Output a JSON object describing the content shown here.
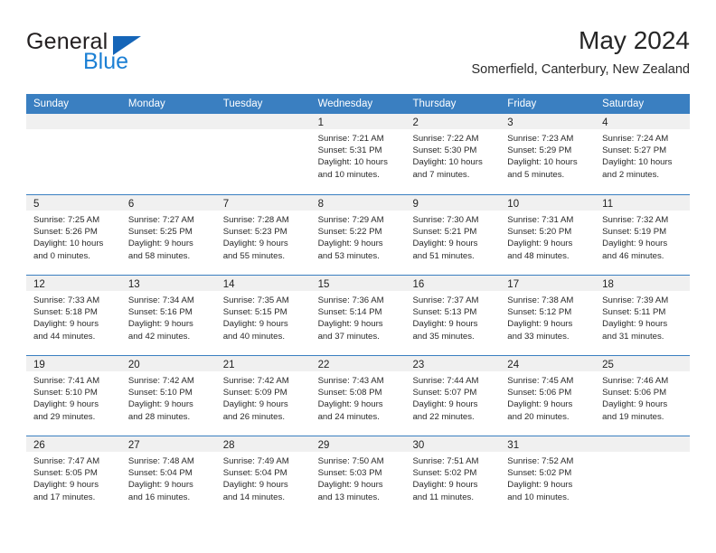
{
  "brand": {
    "name_top": "General",
    "name_bottom": "Blue",
    "triangle_color": "#1565b8",
    "blue_color": "#1b7fd4"
  },
  "header": {
    "title": "May 2024",
    "subtitle": "Somerfield, Canterbury, New Zealand"
  },
  "theme": {
    "header_blue": "#3a7fc1",
    "day_band_gray": "#f0f0f0",
    "text": "#222222"
  },
  "weekdays": [
    "Sunday",
    "Monday",
    "Tuesday",
    "Wednesday",
    "Thursday",
    "Friday",
    "Saturday"
  ],
  "weeks": [
    [
      {
        "day": "",
        "empty": true
      },
      {
        "day": "",
        "empty": true
      },
      {
        "day": "",
        "empty": true
      },
      {
        "day": "1",
        "sunrise": "Sunrise: 7:21 AM",
        "sunset": "Sunset: 5:31 PM",
        "daylight1": "Daylight: 10 hours",
        "daylight2": "and 10 minutes."
      },
      {
        "day": "2",
        "sunrise": "Sunrise: 7:22 AM",
        "sunset": "Sunset: 5:30 PM",
        "daylight1": "Daylight: 10 hours",
        "daylight2": "and 7 minutes."
      },
      {
        "day": "3",
        "sunrise": "Sunrise: 7:23 AM",
        "sunset": "Sunset: 5:29 PM",
        "daylight1": "Daylight: 10 hours",
        "daylight2": "and 5 minutes."
      },
      {
        "day": "4",
        "sunrise": "Sunrise: 7:24 AM",
        "sunset": "Sunset: 5:27 PM",
        "daylight1": "Daylight: 10 hours",
        "daylight2": "and 2 minutes."
      }
    ],
    [
      {
        "day": "5",
        "sunrise": "Sunrise: 7:25 AM",
        "sunset": "Sunset: 5:26 PM",
        "daylight1": "Daylight: 10 hours",
        "daylight2": "and 0 minutes."
      },
      {
        "day": "6",
        "sunrise": "Sunrise: 7:27 AM",
        "sunset": "Sunset: 5:25 PM",
        "daylight1": "Daylight: 9 hours",
        "daylight2": "and 58 minutes."
      },
      {
        "day": "7",
        "sunrise": "Sunrise: 7:28 AM",
        "sunset": "Sunset: 5:23 PM",
        "daylight1": "Daylight: 9 hours",
        "daylight2": "and 55 minutes."
      },
      {
        "day": "8",
        "sunrise": "Sunrise: 7:29 AM",
        "sunset": "Sunset: 5:22 PM",
        "daylight1": "Daylight: 9 hours",
        "daylight2": "and 53 minutes."
      },
      {
        "day": "9",
        "sunrise": "Sunrise: 7:30 AM",
        "sunset": "Sunset: 5:21 PM",
        "daylight1": "Daylight: 9 hours",
        "daylight2": "and 51 minutes."
      },
      {
        "day": "10",
        "sunrise": "Sunrise: 7:31 AM",
        "sunset": "Sunset: 5:20 PM",
        "daylight1": "Daylight: 9 hours",
        "daylight2": "and 48 minutes."
      },
      {
        "day": "11",
        "sunrise": "Sunrise: 7:32 AM",
        "sunset": "Sunset: 5:19 PM",
        "daylight1": "Daylight: 9 hours",
        "daylight2": "and 46 minutes."
      }
    ],
    [
      {
        "day": "12",
        "sunrise": "Sunrise: 7:33 AM",
        "sunset": "Sunset: 5:18 PM",
        "daylight1": "Daylight: 9 hours",
        "daylight2": "and 44 minutes."
      },
      {
        "day": "13",
        "sunrise": "Sunrise: 7:34 AM",
        "sunset": "Sunset: 5:16 PM",
        "daylight1": "Daylight: 9 hours",
        "daylight2": "and 42 minutes."
      },
      {
        "day": "14",
        "sunrise": "Sunrise: 7:35 AM",
        "sunset": "Sunset: 5:15 PM",
        "daylight1": "Daylight: 9 hours",
        "daylight2": "and 40 minutes."
      },
      {
        "day": "15",
        "sunrise": "Sunrise: 7:36 AM",
        "sunset": "Sunset: 5:14 PM",
        "daylight1": "Daylight: 9 hours",
        "daylight2": "and 37 minutes."
      },
      {
        "day": "16",
        "sunrise": "Sunrise: 7:37 AM",
        "sunset": "Sunset: 5:13 PM",
        "daylight1": "Daylight: 9 hours",
        "daylight2": "and 35 minutes."
      },
      {
        "day": "17",
        "sunrise": "Sunrise: 7:38 AM",
        "sunset": "Sunset: 5:12 PM",
        "daylight1": "Daylight: 9 hours",
        "daylight2": "and 33 minutes."
      },
      {
        "day": "18",
        "sunrise": "Sunrise: 7:39 AM",
        "sunset": "Sunset: 5:11 PM",
        "daylight1": "Daylight: 9 hours",
        "daylight2": "and 31 minutes."
      }
    ],
    [
      {
        "day": "19",
        "sunrise": "Sunrise: 7:41 AM",
        "sunset": "Sunset: 5:10 PM",
        "daylight1": "Daylight: 9 hours",
        "daylight2": "and 29 minutes."
      },
      {
        "day": "20",
        "sunrise": "Sunrise: 7:42 AM",
        "sunset": "Sunset: 5:10 PM",
        "daylight1": "Daylight: 9 hours",
        "daylight2": "and 28 minutes."
      },
      {
        "day": "21",
        "sunrise": "Sunrise: 7:42 AM",
        "sunset": "Sunset: 5:09 PM",
        "daylight1": "Daylight: 9 hours",
        "daylight2": "and 26 minutes."
      },
      {
        "day": "22",
        "sunrise": "Sunrise: 7:43 AM",
        "sunset": "Sunset: 5:08 PM",
        "daylight1": "Daylight: 9 hours",
        "daylight2": "and 24 minutes."
      },
      {
        "day": "23",
        "sunrise": "Sunrise: 7:44 AM",
        "sunset": "Sunset: 5:07 PM",
        "daylight1": "Daylight: 9 hours",
        "daylight2": "and 22 minutes."
      },
      {
        "day": "24",
        "sunrise": "Sunrise: 7:45 AM",
        "sunset": "Sunset: 5:06 PM",
        "daylight1": "Daylight: 9 hours",
        "daylight2": "and 20 minutes."
      },
      {
        "day": "25",
        "sunrise": "Sunrise: 7:46 AM",
        "sunset": "Sunset: 5:06 PM",
        "daylight1": "Daylight: 9 hours",
        "daylight2": "and 19 minutes."
      }
    ],
    [
      {
        "day": "26",
        "sunrise": "Sunrise: 7:47 AM",
        "sunset": "Sunset: 5:05 PM",
        "daylight1": "Daylight: 9 hours",
        "daylight2": "and 17 minutes."
      },
      {
        "day": "27",
        "sunrise": "Sunrise: 7:48 AM",
        "sunset": "Sunset: 5:04 PM",
        "daylight1": "Daylight: 9 hours",
        "daylight2": "and 16 minutes."
      },
      {
        "day": "28",
        "sunrise": "Sunrise: 7:49 AM",
        "sunset": "Sunset: 5:04 PM",
        "daylight1": "Daylight: 9 hours",
        "daylight2": "and 14 minutes."
      },
      {
        "day": "29",
        "sunrise": "Sunrise: 7:50 AM",
        "sunset": "Sunset: 5:03 PM",
        "daylight1": "Daylight: 9 hours",
        "daylight2": "and 13 minutes."
      },
      {
        "day": "30",
        "sunrise": "Sunrise: 7:51 AM",
        "sunset": "Sunset: 5:02 PM",
        "daylight1": "Daylight: 9 hours",
        "daylight2": "and 11 minutes."
      },
      {
        "day": "31",
        "sunrise": "Sunrise: 7:52 AM",
        "sunset": "Sunset: 5:02 PM",
        "daylight1": "Daylight: 9 hours",
        "daylight2": "and 10 minutes."
      },
      {
        "day": "",
        "empty": true
      }
    ]
  ]
}
